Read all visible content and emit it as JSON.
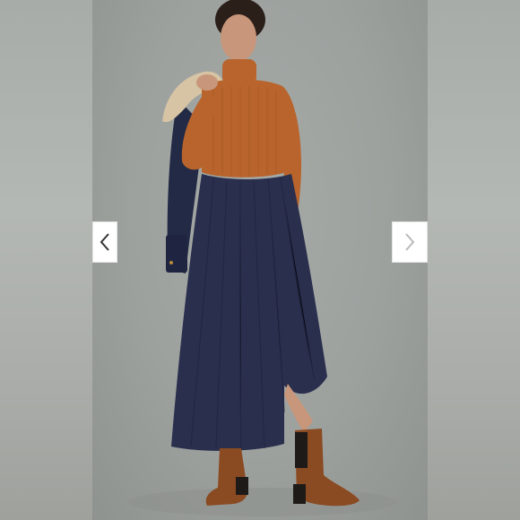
{
  "gallery": {
    "image_alt": "",
    "prev_label": "",
    "next_label": "",
    "prev_icon": "chevron-left-icon",
    "next_icon": "chevron-right-icon"
  },
  "colors": {
    "side_blur": "#a7aca8",
    "backdrop": "#9da19e",
    "sweater": "#b8642c",
    "skirt": "#2a2f4e",
    "boots": "#8a4a22",
    "jacket": "#232a45",
    "shearling": "#d7c4a4",
    "nav_next_icon": "#b9b9b9",
    "nav_prev_icon": "#333333"
  }
}
